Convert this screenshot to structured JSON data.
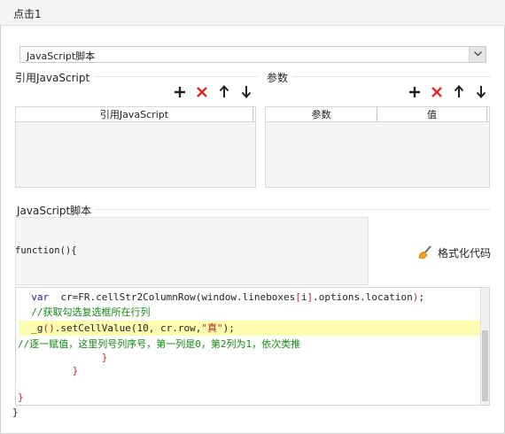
{
  "window": {
    "title": "点击1"
  },
  "script_type": {
    "selected": "JavaScript脚本"
  },
  "ref_js": {
    "group_label": "引用JavaScript",
    "column_header": "引用JavaScript"
  },
  "params": {
    "group_label": "参数",
    "columns": [
      "参数",
      "值"
    ]
  },
  "script": {
    "group_label": "JavaScript脚本",
    "function_head": "function(){",
    "format_button": "格式化代码",
    "code_lines": [
      {
        "indent": "  ",
        "parts": [
          [
            "kw",
            "var"
          ],
          [
            "",
            "  cr=FR.cellStr2ColumnRow("
          ],
          [
            "",
            "window.lineboxes"
          ],
          [
            "red",
            "["
          ],
          [
            "",
            "i"
          ],
          [
            "red",
            "]"
          ],
          [
            "",
            ".options.location"
          ],
          [
            "red",
            ")"
          ],
          [
            "",
            ";"
          ]
        ]
      },
      {
        "indent": "  ",
        "parts": [
          [
            "grn",
            "//获取勾选复选框所在行列"
          ]
        ]
      },
      {
        "indent": "  ",
        "parts": [
          [
            "",
            "_g"
          ],
          [
            "red",
            "()"
          ],
          [
            "",
            ".setCellValue(10, cr.row,"
          ],
          [
            "str",
            "\"真\""
          ],
          [
            "",
            ");"
          ]
        ]
      },
      {
        "indent": "",
        "parts": [
          [
            "grn",
            "//逐一赋值，这里列号列序号，第一列是0，第2列为1，依次类推"
          ]
        ]
      },
      {
        "indent": "              ",
        "parts": [
          [
            "red",
            "}"
          ]
        ]
      },
      {
        "indent": "         ",
        "parts": [
          [
            "red",
            "}"
          ]
        ]
      },
      {
        "indent": "",
        "parts": []
      },
      {
        "indent": "",
        "parts": [
          [
            "red",
            "}"
          ]
        ]
      }
    ],
    "closing_brace": "}"
  },
  "icons": {
    "add": "plus-icon",
    "delete": "red-x-icon",
    "move_up": "arrow-up-icon",
    "move_down": "arrow-down-icon",
    "format": "broom-icon",
    "dropdown": "chevron-down-icon"
  },
  "colors": {
    "delete_red": "#e02a2a",
    "highlight_line": "#fdfdb0",
    "comment_green": "#138a13"
  }
}
